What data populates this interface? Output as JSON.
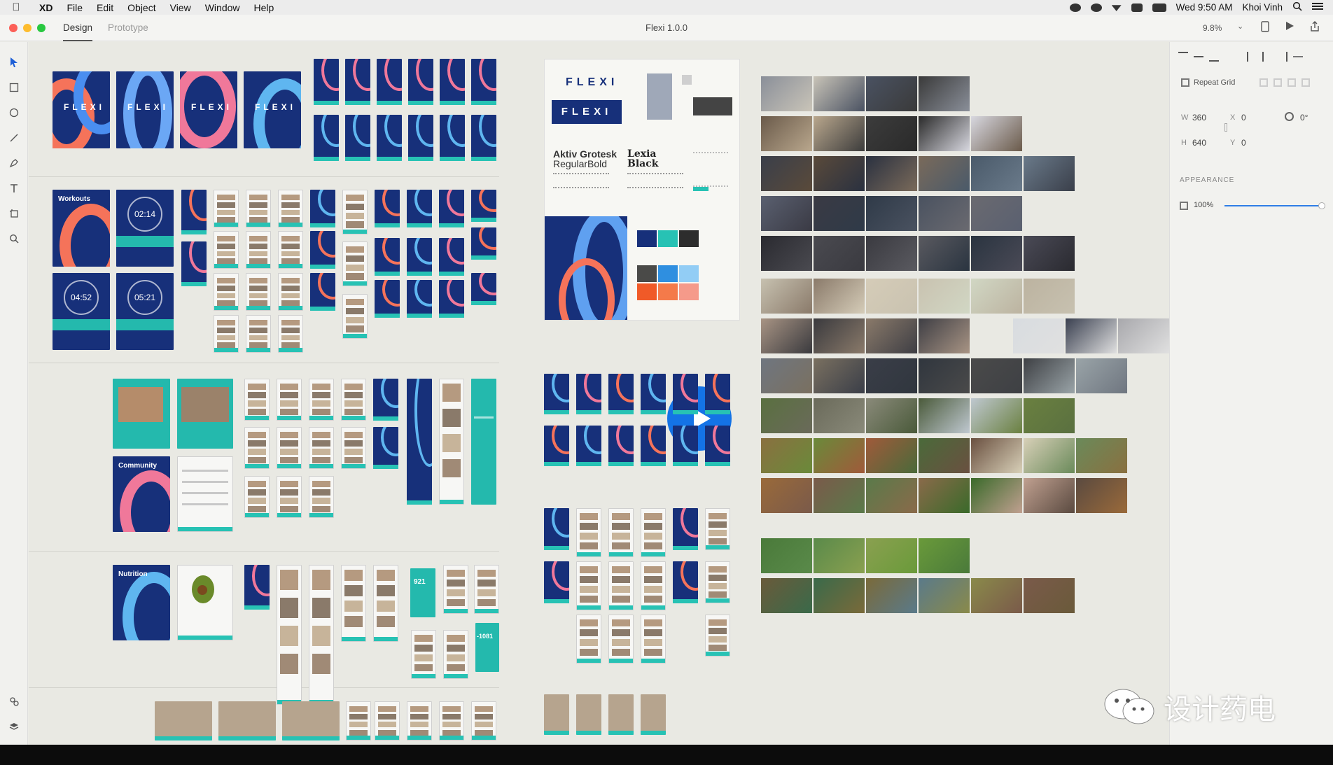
{
  "menubar": {
    "app": "XD",
    "items": [
      "File",
      "Edit",
      "Object",
      "View",
      "Window",
      "Help"
    ],
    "clock": "Wed 9:50 AM",
    "user": "Khoi Vinh"
  },
  "window": {
    "title": "Flexi 1.0.0",
    "tabs": [
      "Design",
      "Prototype"
    ],
    "zoom": "9.8%"
  },
  "panel": {
    "repeat_grid": "Repeat Grid",
    "w_label": "W",
    "w": "360",
    "h_label": "H",
    "h": "640",
    "x_label": "X",
    "x": "0",
    "y_label": "Y",
    "y": "0",
    "rotation": "0°",
    "appearance_label": "APPEARANCE",
    "opacity": "100%",
    "opacity_level": 1.0
  },
  "style_guide": {
    "logo": "FLEXI",
    "font_primary": "Aktiv Grotesk",
    "font_primary_weights": "RegularBold",
    "font_secondary": "Lexia",
    "font_secondary_weight": "Black",
    "swatches": [
      "#17307a",
      "#27c2b4",
      "#2d2d2d",
      "#4a4a48",
      "#2f8fe0",
      "#92cdf5",
      "#f05a28",
      "#f47a4a",
      "#f59a8a"
    ]
  },
  "artboard_text": {
    "workouts": "Workouts",
    "timer1": "02:14",
    "timer2": "04:52",
    "timer3": "05:21",
    "community": "Community",
    "nutrition": "Nutrition",
    "count": "921",
    "calories": "-1081"
  },
  "watermark": "设计药电",
  "colors": {
    "navy": "#17307a",
    "teal": "#27c2b4",
    "accent_blue": "#1473e6"
  }
}
